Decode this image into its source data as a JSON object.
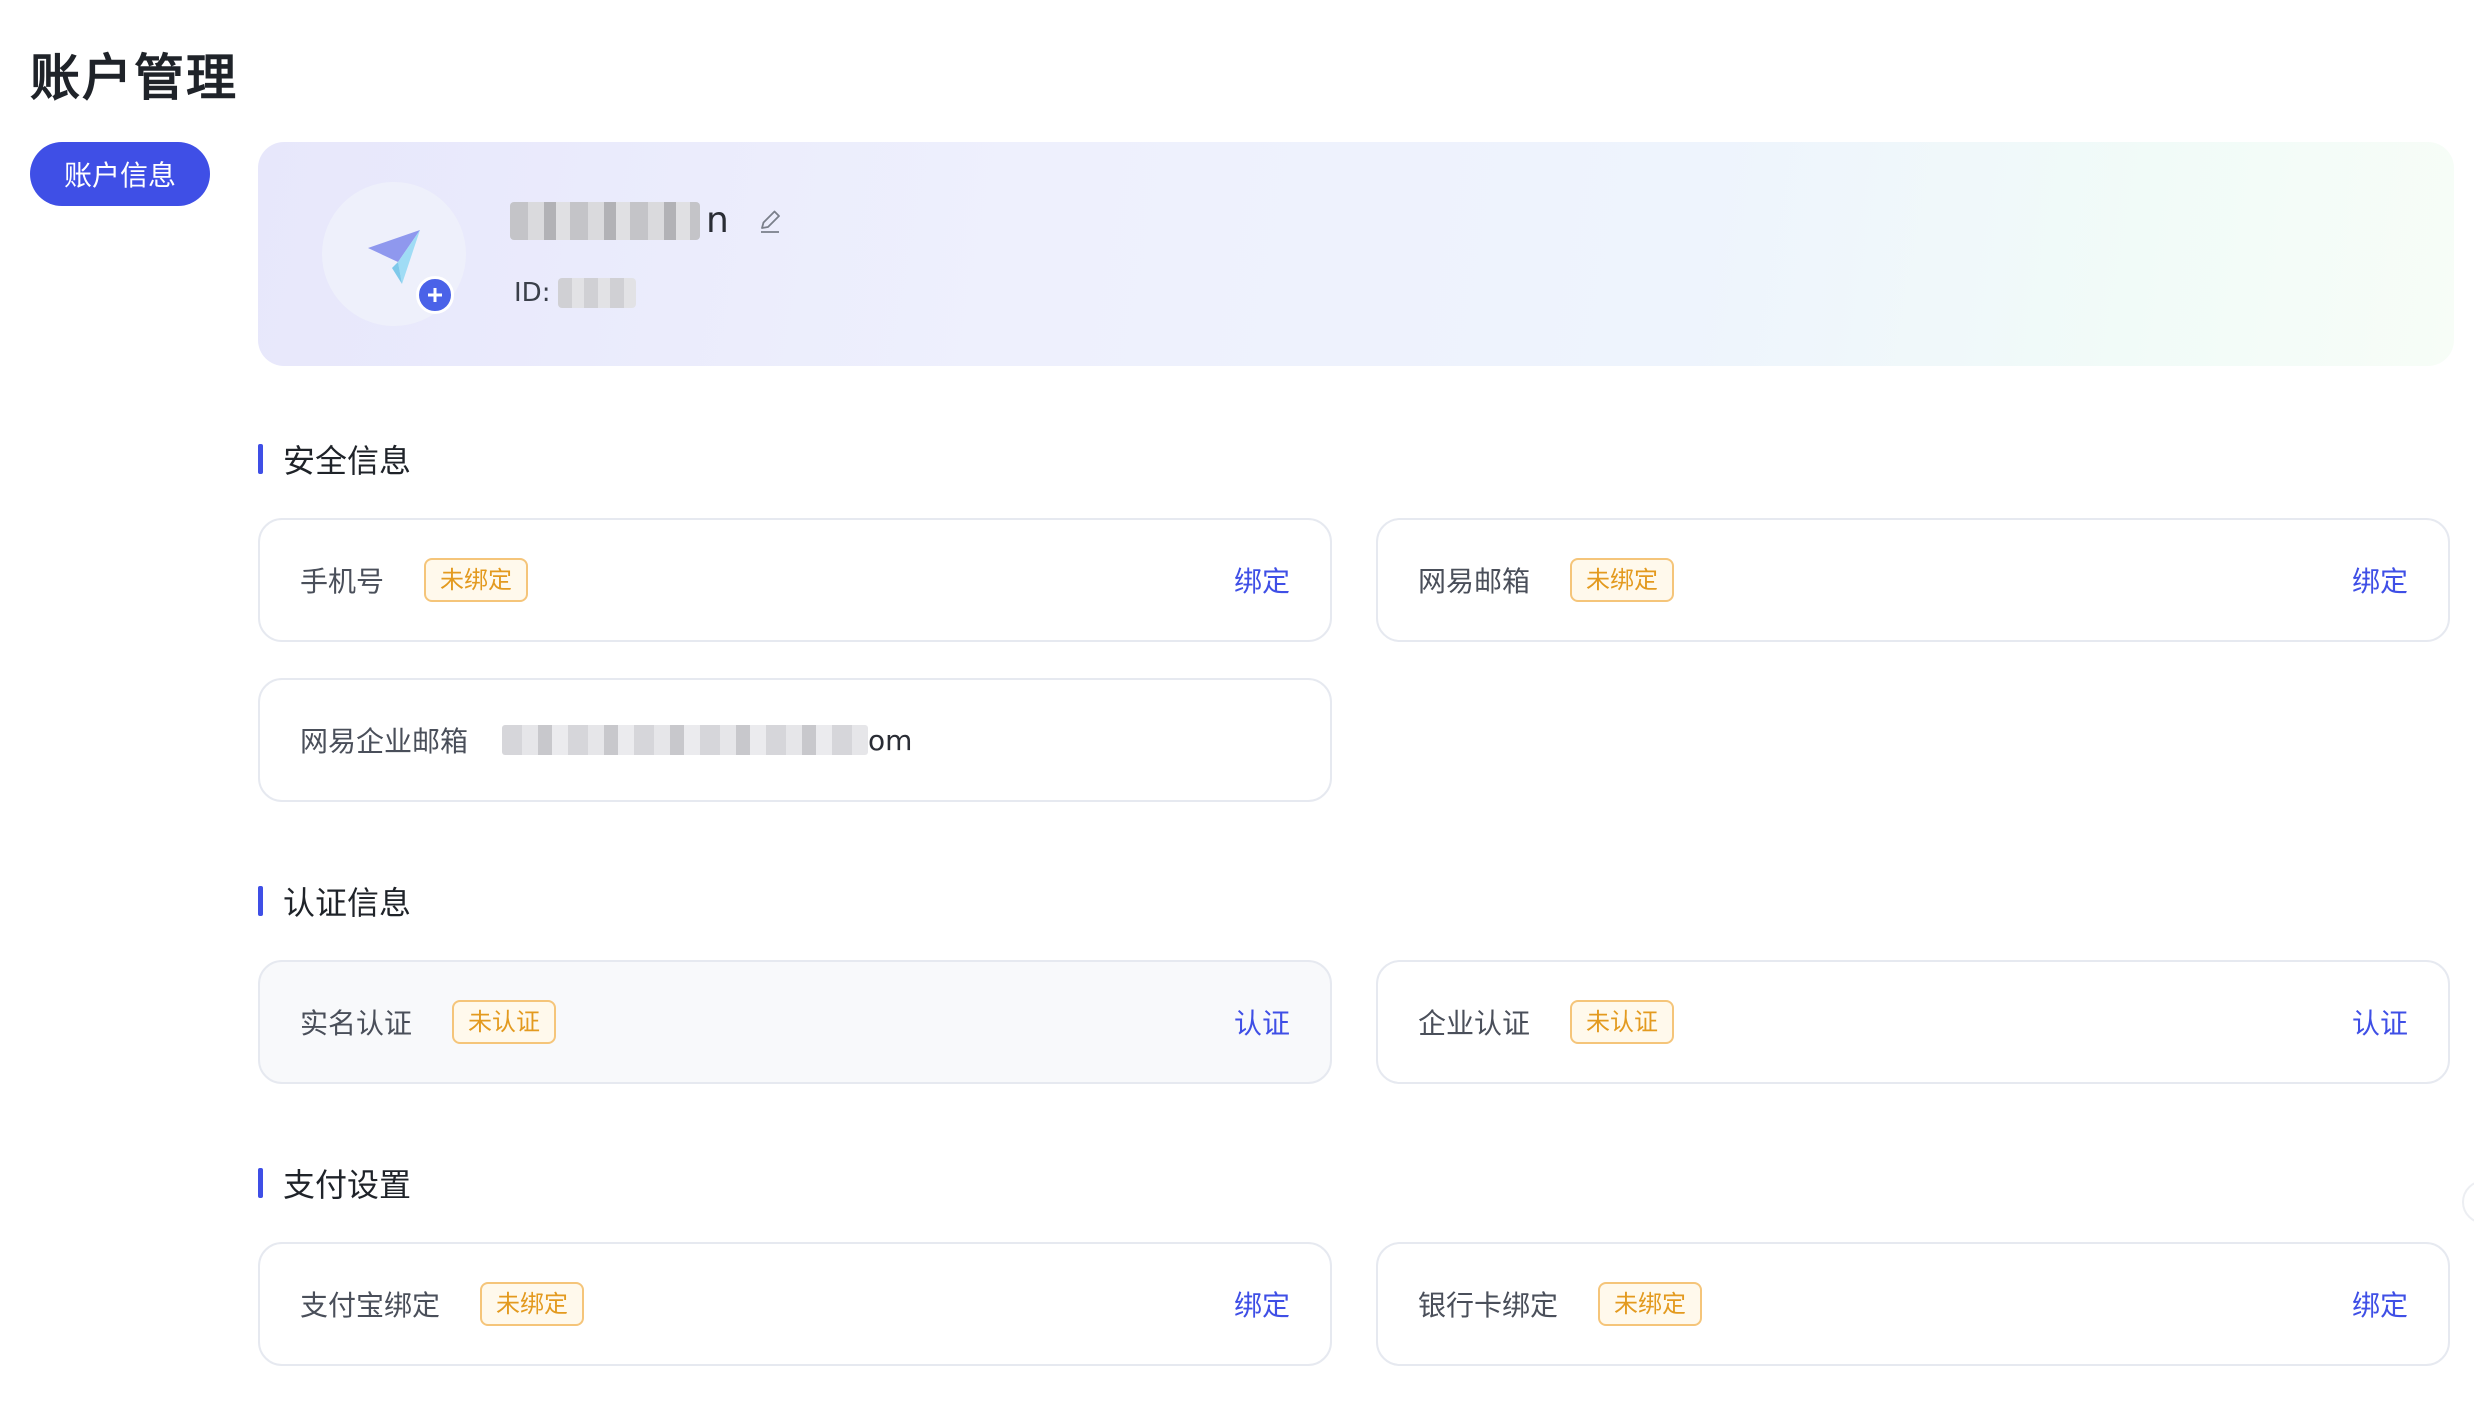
{
  "page": {
    "title": "账户管理"
  },
  "sidebar": {
    "items": [
      {
        "label": "账户信息",
        "active": true
      }
    ]
  },
  "profile": {
    "username_visible_tail": "n",
    "id_label": "ID:"
  },
  "sections": {
    "security": {
      "title": "安全信息",
      "phone": {
        "label": "手机号",
        "badge": "未绑定",
        "action": "绑定"
      },
      "netease_mail": {
        "label": "网易邮箱",
        "badge": "未绑定",
        "action": "绑定"
      },
      "enterprise_mail": {
        "label": "网易企业邮箱",
        "value_visible_tail": "om"
      }
    },
    "verification": {
      "title": "认证信息",
      "realname": {
        "label": "实名认证",
        "badge": "未认证",
        "action": "认证"
      },
      "enterprise": {
        "label": "企业认证",
        "badge": "未认证",
        "action": "认证"
      }
    },
    "payment": {
      "title": "支付设置",
      "alipay": {
        "label": "支付宝绑定",
        "badge": "未绑定",
        "action": "绑定"
      },
      "bankcard": {
        "label": "银行卡绑定",
        "badge": "未绑定",
        "action": "绑定"
      }
    }
  },
  "colors": {
    "accent": "#3f4fe6",
    "badge_text": "#e39a1f",
    "badge_border": "#f5c57a",
    "badge_bg": "#fff9ec"
  }
}
